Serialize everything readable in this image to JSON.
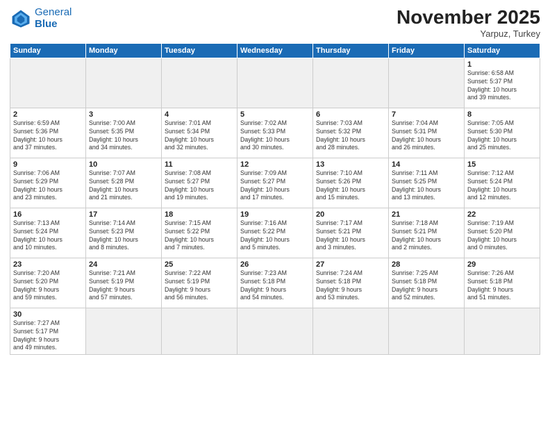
{
  "logo": {
    "line1": "General",
    "line2": "Blue"
  },
  "title": "November 2025",
  "subtitle": "Yarpuz, Turkey",
  "days_header": [
    "Sunday",
    "Monday",
    "Tuesday",
    "Wednesday",
    "Thursday",
    "Friday",
    "Saturday"
  ],
  "weeks": [
    [
      {
        "day": "",
        "info": "",
        "empty": true
      },
      {
        "day": "",
        "info": "",
        "empty": true
      },
      {
        "day": "",
        "info": "",
        "empty": true
      },
      {
        "day": "",
        "info": "",
        "empty": true
      },
      {
        "day": "",
        "info": "",
        "empty": true
      },
      {
        "day": "",
        "info": "",
        "empty": true
      },
      {
        "day": "1",
        "info": "Sunrise: 6:58 AM\nSunset: 5:37 PM\nDaylight: 10 hours\nand 39 minutes.",
        "empty": false
      }
    ],
    [
      {
        "day": "2",
        "info": "Sunrise: 6:59 AM\nSunset: 5:36 PM\nDaylight: 10 hours\nand 37 minutes.",
        "empty": false
      },
      {
        "day": "3",
        "info": "Sunrise: 7:00 AM\nSunset: 5:35 PM\nDaylight: 10 hours\nand 34 minutes.",
        "empty": false
      },
      {
        "day": "4",
        "info": "Sunrise: 7:01 AM\nSunset: 5:34 PM\nDaylight: 10 hours\nand 32 minutes.",
        "empty": false
      },
      {
        "day": "5",
        "info": "Sunrise: 7:02 AM\nSunset: 5:33 PM\nDaylight: 10 hours\nand 30 minutes.",
        "empty": false
      },
      {
        "day": "6",
        "info": "Sunrise: 7:03 AM\nSunset: 5:32 PM\nDaylight: 10 hours\nand 28 minutes.",
        "empty": false
      },
      {
        "day": "7",
        "info": "Sunrise: 7:04 AM\nSunset: 5:31 PM\nDaylight: 10 hours\nand 26 minutes.",
        "empty": false
      },
      {
        "day": "8",
        "info": "Sunrise: 7:05 AM\nSunset: 5:30 PM\nDaylight: 10 hours\nand 25 minutes.",
        "empty": false
      }
    ],
    [
      {
        "day": "9",
        "info": "Sunrise: 7:06 AM\nSunset: 5:29 PM\nDaylight: 10 hours\nand 23 minutes.",
        "empty": false
      },
      {
        "day": "10",
        "info": "Sunrise: 7:07 AM\nSunset: 5:28 PM\nDaylight: 10 hours\nand 21 minutes.",
        "empty": false
      },
      {
        "day": "11",
        "info": "Sunrise: 7:08 AM\nSunset: 5:27 PM\nDaylight: 10 hours\nand 19 minutes.",
        "empty": false
      },
      {
        "day": "12",
        "info": "Sunrise: 7:09 AM\nSunset: 5:27 PM\nDaylight: 10 hours\nand 17 minutes.",
        "empty": false
      },
      {
        "day": "13",
        "info": "Sunrise: 7:10 AM\nSunset: 5:26 PM\nDaylight: 10 hours\nand 15 minutes.",
        "empty": false
      },
      {
        "day": "14",
        "info": "Sunrise: 7:11 AM\nSunset: 5:25 PM\nDaylight: 10 hours\nand 13 minutes.",
        "empty": false
      },
      {
        "day": "15",
        "info": "Sunrise: 7:12 AM\nSunset: 5:24 PM\nDaylight: 10 hours\nand 12 minutes.",
        "empty": false
      }
    ],
    [
      {
        "day": "16",
        "info": "Sunrise: 7:13 AM\nSunset: 5:24 PM\nDaylight: 10 hours\nand 10 minutes.",
        "empty": false
      },
      {
        "day": "17",
        "info": "Sunrise: 7:14 AM\nSunset: 5:23 PM\nDaylight: 10 hours\nand 8 minutes.",
        "empty": false
      },
      {
        "day": "18",
        "info": "Sunrise: 7:15 AM\nSunset: 5:22 PM\nDaylight: 10 hours\nand 7 minutes.",
        "empty": false
      },
      {
        "day": "19",
        "info": "Sunrise: 7:16 AM\nSunset: 5:22 PM\nDaylight: 10 hours\nand 5 minutes.",
        "empty": false
      },
      {
        "day": "20",
        "info": "Sunrise: 7:17 AM\nSunset: 5:21 PM\nDaylight: 10 hours\nand 3 minutes.",
        "empty": false
      },
      {
        "day": "21",
        "info": "Sunrise: 7:18 AM\nSunset: 5:21 PM\nDaylight: 10 hours\nand 2 minutes.",
        "empty": false
      },
      {
        "day": "22",
        "info": "Sunrise: 7:19 AM\nSunset: 5:20 PM\nDaylight: 10 hours\nand 0 minutes.",
        "empty": false
      }
    ],
    [
      {
        "day": "23",
        "info": "Sunrise: 7:20 AM\nSunset: 5:20 PM\nDaylight: 9 hours\nand 59 minutes.",
        "empty": false
      },
      {
        "day": "24",
        "info": "Sunrise: 7:21 AM\nSunset: 5:19 PM\nDaylight: 9 hours\nand 57 minutes.",
        "empty": false
      },
      {
        "day": "25",
        "info": "Sunrise: 7:22 AM\nSunset: 5:19 PM\nDaylight: 9 hours\nand 56 minutes.",
        "empty": false
      },
      {
        "day": "26",
        "info": "Sunrise: 7:23 AM\nSunset: 5:18 PM\nDaylight: 9 hours\nand 54 minutes.",
        "empty": false
      },
      {
        "day": "27",
        "info": "Sunrise: 7:24 AM\nSunset: 5:18 PM\nDaylight: 9 hours\nand 53 minutes.",
        "empty": false
      },
      {
        "day": "28",
        "info": "Sunrise: 7:25 AM\nSunset: 5:18 PM\nDaylight: 9 hours\nand 52 minutes.",
        "empty": false
      },
      {
        "day": "29",
        "info": "Sunrise: 7:26 AM\nSunset: 5:18 PM\nDaylight: 9 hours\nand 51 minutes.",
        "empty": false
      }
    ],
    [
      {
        "day": "30",
        "info": "Sunrise: 7:27 AM\nSunset: 5:17 PM\nDaylight: 9 hours\nand 49 minutes.",
        "empty": false
      },
      {
        "day": "",
        "info": "",
        "empty": true
      },
      {
        "day": "",
        "info": "",
        "empty": true
      },
      {
        "day": "",
        "info": "",
        "empty": true
      },
      {
        "day": "",
        "info": "",
        "empty": true
      },
      {
        "day": "",
        "info": "",
        "empty": true
      },
      {
        "day": "",
        "info": "",
        "empty": true
      }
    ]
  ]
}
